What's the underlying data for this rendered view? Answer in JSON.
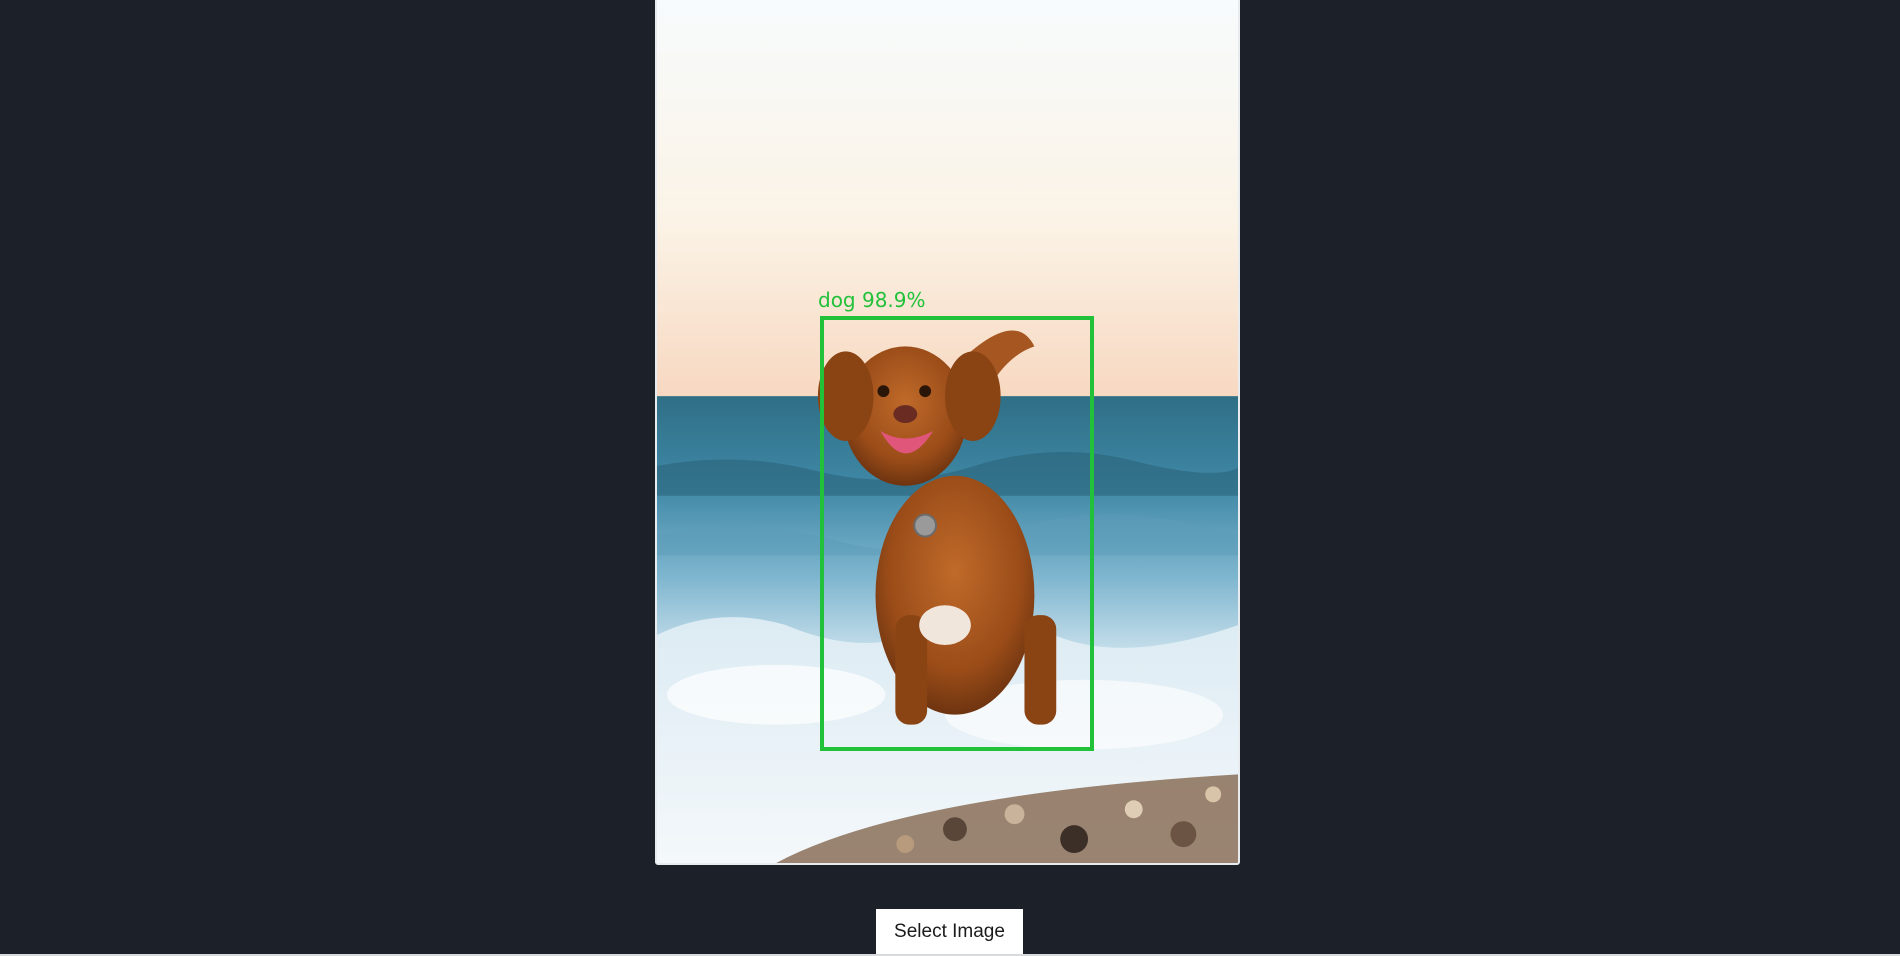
{
  "image_panel": {
    "alt": "Dog running on a beach through ocean foam",
    "detection": {
      "label": "dog 98.9%",
      "class": "dog",
      "confidence_percent": 98.9,
      "color": "#22c13a"
    }
  },
  "controls": {
    "select_image_label": "Select Image"
  },
  "colors": {
    "background": "#1c2029",
    "button_bg": "#ffffff"
  }
}
